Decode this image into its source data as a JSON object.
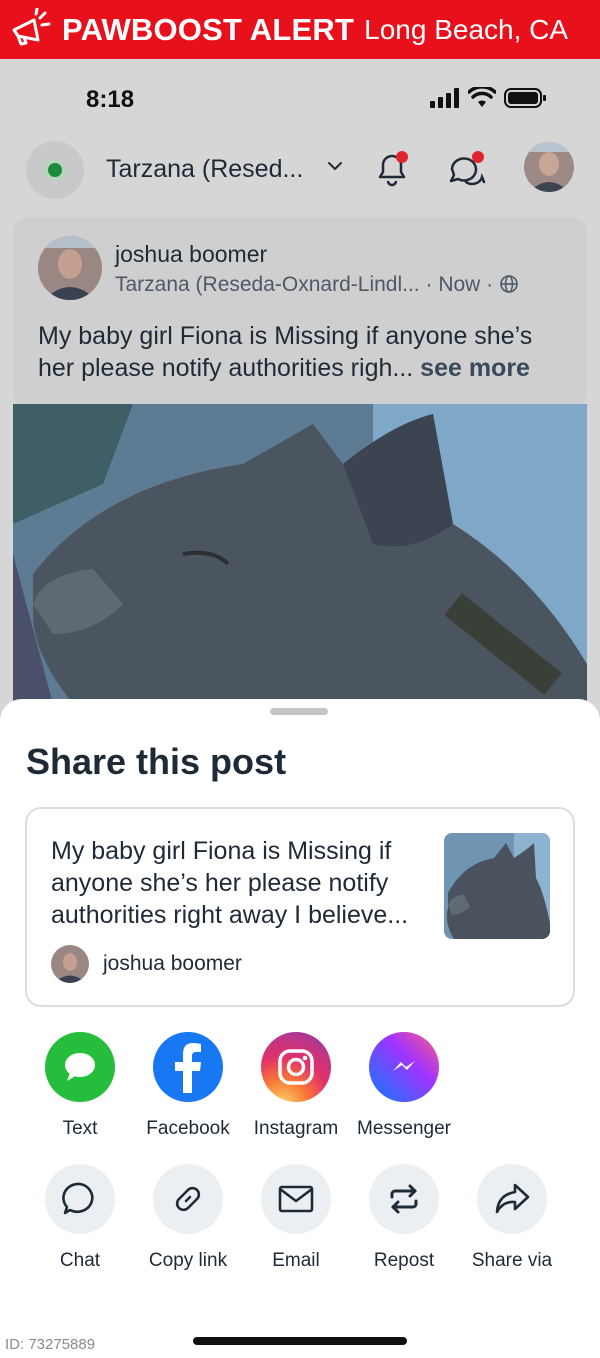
{
  "alert": {
    "brand": "PAWBOOST ALERT",
    "location": "Long Beach, CA"
  },
  "status_bar": {
    "time": "8:18"
  },
  "app_bar": {
    "neighborhood": "Tarzana (Resed..."
  },
  "post": {
    "author": "joshua boomer",
    "location": "Tarzana (Reseda-Oxnard-Lindl...",
    "time": "· Now ·",
    "text": "My baby girl Fiona is Missing if anyone she’s her please notify authorities righ...",
    "see_more": "see more"
  },
  "share_sheet": {
    "title": "Share this post",
    "preview_text": "My baby girl Fiona is Missing if anyone she’s her please notify authorities right away I believe...",
    "preview_author": "joshua boomer",
    "apps": [
      {
        "label": "Text",
        "icon": "message-icon",
        "color": "#27bd3c"
      },
      {
        "label": "Facebook",
        "icon": "facebook-icon",
        "color": "#1877f2"
      },
      {
        "label": "Instagram",
        "icon": "instagram-icon",
        "color": "#e1306c"
      },
      {
        "label": "Messenger",
        "icon": "messenger-icon",
        "color": "#7a5cff"
      }
    ],
    "actions": [
      {
        "label": "Chat",
        "icon": "chat-bubble-icon"
      },
      {
        "label": "Copy link",
        "icon": "link-icon"
      },
      {
        "label": "Email",
        "icon": "mail-icon"
      },
      {
        "label": "Repost",
        "icon": "repost-icon"
      },
      {
        "label": "Share via",
        "icon": "share-arrow-icon"
      }
    ]
  },
  "footer": {
    "id_tag": "ID: 73275889"
  },
  "colors": {
    "alert_red": "#e8101a",
    "text_dark": "#1f2a37",
    "notification_dot": "#e0242e"
  }
}
